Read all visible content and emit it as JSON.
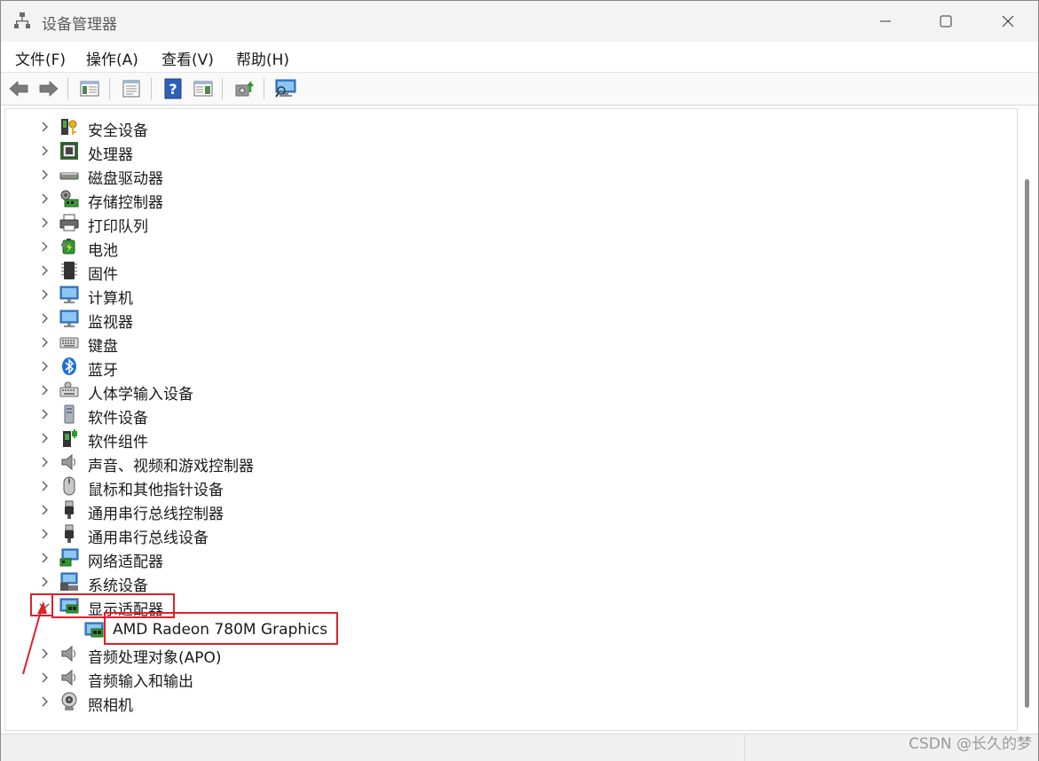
{
  "window": {
    "title": "设备管理器"
  },
  "menu": [
    {
      "label": "文件(F)"
    },
    {
      "label": "操作(A)"
    },
    {
      "label": "查看(V)"
    },
    {
      "label": "帮助(H)"
    }
  ],
  "tree": [
    {
      "label": "安全设备",
      "icon": "security-key-icon",
      "expanded": false
    },
    {
      "label": "处理器",
      "icon": "processor-icon",
      "expanded": false
    },
    {
      "label": "磁盘驱动器",
      "icon": "disk-drive-icon",
      "expanded": false
    },
    {
      "label": "存储控制器",
      "icon": "storage-controller-icon",
      "expanded": false
    },
    {
      "label": "打印队列",
      "icon": "printer-icon",
      "expanded": false
    },
    {
      "label": "电池",
      "icon": "battery-icon",
      "expanded": false
    },
    {
      "label": "固件",
      "icon": "firmware-chip-icon",
      "expanded": false
    },
    {
      "label": "计算机",
      "icon": "computer-icon",
      "expanded": false
    },
    {
      "label": "监视器",
      "icon": "monitor-icon",
      "expanded": false
    },
    {
      "label": "键盘",
      "icon": "keyboard-icon",
      "expanded": false
    },
    {
      "label": "蓝牙",
      "icon": "bluetooth-icon",
      "expanded": false
    },
    {
      "label": "人体学输入设备",
      "icon": "hid-icon",
      "expanded": false
    },
    {
      "label": "软件设备",
      "icon": "software-device-icon",
      "expanded": false
    },
    {
      "label": "软件组件",
      "icon": "software-component-icon",
      "expanded": false
    },
    {
      "label": "声音、视频和游戏控制器",
      "icon": "speaker-icon",
      "expanded": false
    },
    {
      "label": "鼠标和其他指针设备",
      "icon": "mouse-icon",
      "expanded": false
    },
    {
      "label": "通用串行总线控制器",
      "icon": "usb-icon",
      "expanded": false
    },
    {
      "label": "通用串行总线设备",
      "icon": "usb-icon",
      "expanded": false
    },
    {
      "label": "网络适配器",
      "icon": "network-adapter-icon",
      "expanded": false
    },
    {
      "label": "系统设备",
      "icon": "system-device-icon",
      "expanded": false
    },
    {
      "label": "显示适配器",
      "icon": "display-adapter-icon",
      "expanded": true
    },
    {
      "label": "AMD Radeon 780M Graphics",
      "icon": "display-adapter-icon",
      "child": true
    },
    {
      "label": "音频处理对象(APO)",
      "icon": "speaker-icon",
      "expanded": false
    },
    {
      "label": "音频输入和输出",
      "icon": "speaker-icon",
      "expanded": false
    },
    {
      "label": "照相机",
      "icon": "camera-icon",
      "expanded": false
    }
  ],
  "watermark": "CSDN @长久的梦",
  "colors": {
    "highlight": "#e0202a",
    "accent": "#1e7fd6"
  }
}
